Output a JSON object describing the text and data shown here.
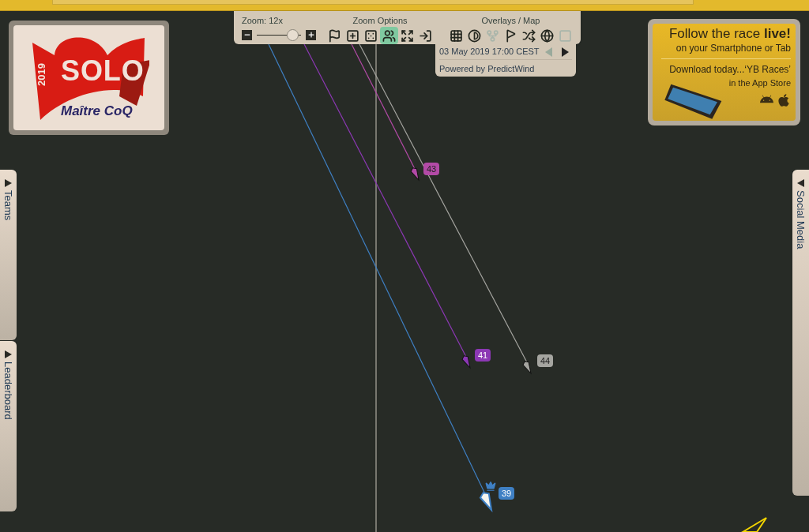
{
  "toolbar": {
    "zoom": {
      "label": "Zoom: 12x",
      "level": 0.8
    },
    "zoom_options": {
      "title": "Zoom Options",
      "tools": [
        {
          "kind": "flag",
          "on": false
        },
        {
          "kind": "plus",
          "on": false
        },
        {
          "kind": "dice",
          "on": false
        },
        {
          "kind": "group",
          "on": true
        },
        {
          "kind": "expand",
          "on": false
        },
        {
          "kind": "enter",
          "on": false
        }
      ]
    },
    "overlays": {
      "title": "Overlays / Map",
      "tools": [
        {
          "kind": "grid",
          "disabled": false
        },
        {
          "kind": "contrast",
          "disabled": false
        },
        {
          "kind": "fork",
          "disabled": true
        },
        {
          "kind": "windsock",
          "disabled": false
        },
        {
          "kind": "shuffle",
          "disabled": false
        },
        {
          "kind": "globe",
          "disabled": false
        },
        {
          "kind": "square",
          "disabled": true
        }
      ]
    }
  },
  "timeline": {
    "datetime": "03 May 2019 17:00 CEST",
    "prev_disabled": true,
    "next_disabled": false,
    "credit": "Powered by PredictWind"
  },
  "logo": {
    "year": "2019",
    "title": "SOLO",
    "subtitle": "Maître CoQ"
  },
  "promo": {
    "headline": "Follow the race **live!**",
    "subline": "on your Smartphone or Tab",
    "download": "Download today...‘YB Races’",
    "store": "in the App Store"
  },
  "side_tabs": {
    "left": [
      "Teams",
      "Leaderboard"
    ],
    "right": [
      "Social Media"
    ]
  },
  "boats": [
    {
      "label": "43",
      "color": "#b24aa6",
      "leader": false
    },
    {
      "label": "41",
      "color": "#8c38b4",
      "leader": false
    },
    {
      "label": "44",
      "color": "#a5a5a0",
      "leader": false
    },
    {
      "label": "39",
      "color": "#3f80c4",
      "leader": true
    }
  ]
}
